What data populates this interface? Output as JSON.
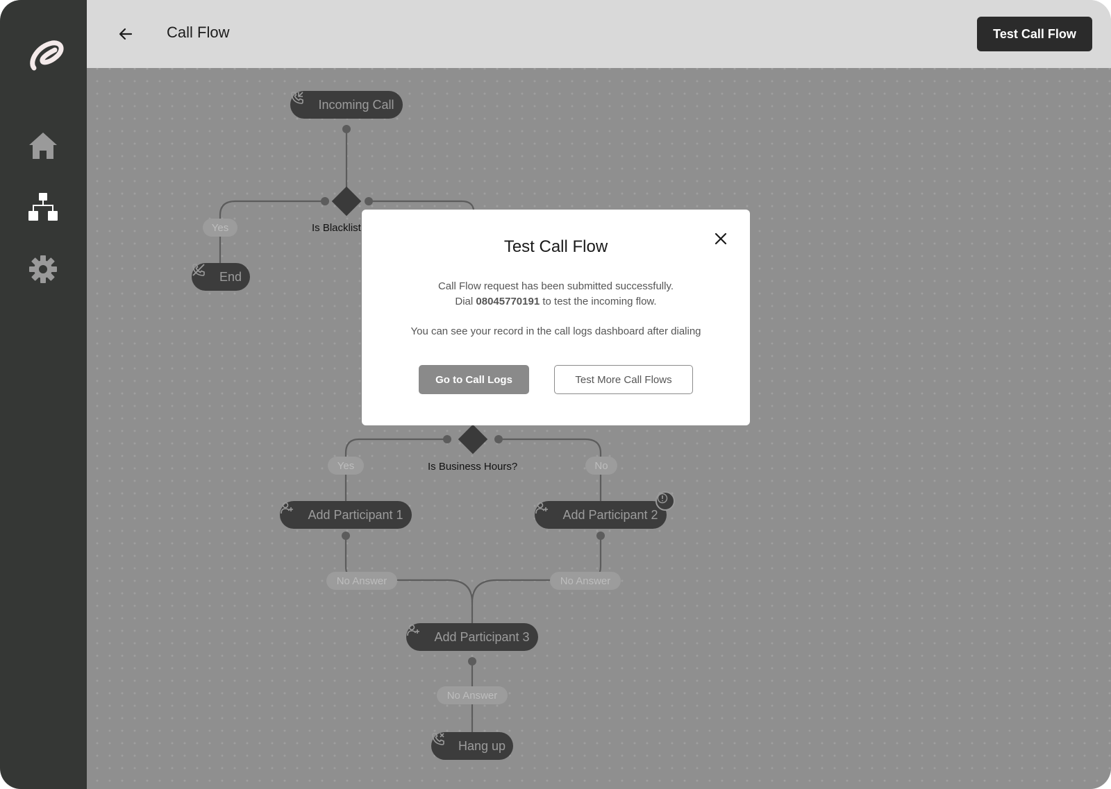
{
  "header": {
    "title": "Call Flow",
    "test_button": "Test Call Flow"
  },
  "sidebar": {
    "items": [
      {
        "name": "logo"
      },
      {
        "name": "home-icon"
      },
      {
        "name": "call-flow-icon"
      },
      {
        "name": "settings-icon"
      }
    ]
  },
  "flow": {
    "nodes": {
      "incoming_call": "Incoming Call",
      "end": "End",
      "add_participant_1": "Add Participant 1",
      "add_participant_2": "Add Participant 2",
      "add_participant_3": "Add Participant 3",
      "hang_up": "Hang up"
    },
    "conditions": {
      "blacklist": "Is Blacklist",
      "business_hours": "Is Business Hours?"
    },
    "tags": {
      "blacklist_yes": "Yes",
      "hours_yes": "Yes",
      "hours_no": "No",
      "no_answer_1": "No Answer",
      "no_answer_2": "No Answer",
      "no_answer_3": "No Answer"
    }
  },
  "modal": {
    "title": "Test Call Flow",
    "message_line1": "Call Flow request has been submitted successfully.",
    "message_dial_prefix": "Dial",
    "phone_number": "08045770191",
    "message_dial_suffix": "to test the incoming flow.",
    "note": "You can see your record in the call logs dashboard after dialing",
    "primary_button": "Go to Call Logs",
    "secondary_button": "Test More Call Flows"
  },
  "colors": {
    "sidebar": "#353735",
    "header": "#d9d9d9",
    "overlay_canvas": "#8f8f8f",
    "node_bg": "#3c3c3c",
    "primary_button": "#2b2b2b"
  }
}
